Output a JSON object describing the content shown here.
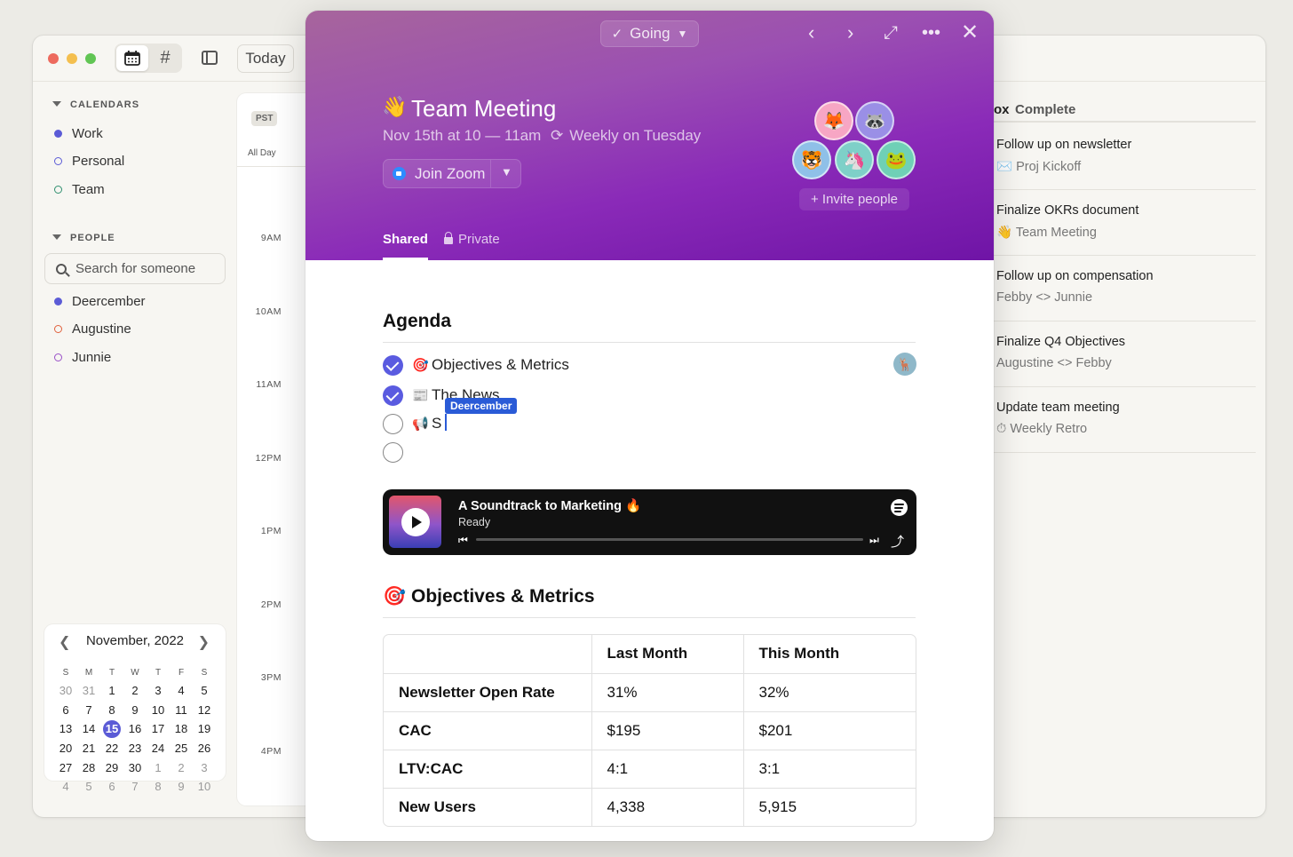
{
  "app": {
    "today_label": "Today",
    "sections": {
      "calendars": "CALENDARS",
      "people": "PEOPLE"
    },
    "calendars": [
      {
        "label": "Work",
        "color": "#5b5bd6",
        "filled": true
      },
      {
        "label": "Personal",
        "color": "#5b5bd6",
        "filled": false
      },
      {
        "label": "Team",
        "color": "#2f8f6f",
        "filled": false
      }
    ],
    "people_search_placeholder": "Search for someone",
    "people": [
      {
        "label": "Deercember",
        "color": "#5b5bd6",
        "filled": true
      },
      {
        "label": "Augustine",
        "color": "#e0603c",
        "filled": false
      },
      {
        "label": "Junnie",
        "color": "#9a50c8",
        "filled": false
      }
    ],
    "mini_calendar": {
      "title": "November, 2022",
      "weekdays": [
        "S",
        "M",
        "T",
        "W",
        "T",
        "F",
        "S"
      ],
      "weeks": [
        [
          "30",
          "31",
          "1",
          "2",
          "3",
          "4",
          "5"
        ],
        [
          "6",
          "7",
          "8",
          "9",
          "10",
          "11",
          "12"
        ],
        [
          "13",
          "14",
          "15",
          "16",
          "17",
          "18",
          "19"
        ],
        [
          "20",
          "21",
          "22",
          "23",
          "24",
          "25",
          "26"
        ],
        [
          "27",
          "28",
          "29",
          "30",
          "1",
          "2",
          "3"
        ],
        [
          "4",
          "5",
          "6",
          "7",
          "8",
          "9",
          "10"
        ]
      ],
      "today": "15"
    },
    "timeline": {
      "timezone": "PST",
      "all_day": "All Day",
      "hours": [
        "9AM",
        "10AM",
        "11AM",
        "12PM",
        "1PM",
        "2PM",
        "3PM",
        "4PM"
      ]
    },
    "tasks": {
      "tab_inbox": "ox",
      "tab_complete": "Complete",
      "items": [
        {
          "title": "Follow up on newsletter",
          "sub": "✉️ Proj Kickoff"
        },
        {
          "title": "Finalize OKRs document",
          "sub": "👋 Team Meeting"
        },
        {
          "title": "Follow up on compensation",
          "sub": "Febby <> Junnie"
        },
        {
          "title": "Finalize Q4 Objectives",
          "sub": "Augustine <> Febby"
        },
        {
          "title": "Update team meeting",
          "sub": "⏱ Weekly Retro"
        }
      ]
    }
  },
  "event": {
    "rsvp": "Going",
    "emoji": "👋",
    "title": "Team Meeting",
    "when": "Nov 15th at 10 — 11am",
    "repeat": "Weekly on Tuesday",
    "zoom_label": "Join Zoom",
    "invite_label": "+ Invite people",
    "tabs": {
      "shared": "Shared",
      "private": "Private"
    },
    "avatars": [
      "🦊",
      "🦝",
      "🐯",
      "🦄",
      "🐸"
    ],
    "agenda_title": "Agenda",
    "agenda": [
      {
        "emoji": "🎯",
        "text": "Objectives & Metrics",
        "checked": true
      },
      {
        "emoji": "📰",
        "text": "The News",
        "checked": true
      },
      {
        "emoji": "📢",
        "text": "S",
        "checked": false
      },
      {
        "emoji": "",
        "text": "",
        "checked": false
      }
    ],
    "cursor_user": "Deercember",
    "player": {
      "title": "A Soundtrack to Marketing 🔥",
      "status": "Ready"
    },
    "metrics_emoji": "🎯",
    "metrics_title": "Objectives & Metrics",
    "table": {
      "headers": [
        "",
        "Last Month",
        "This Month"
      ],
      "rows": [
        [
          "Newsletter Open Rate",
          "31%",
          "32%"
        ],
        [
          "CAC",
          "$195",
          "$201"
        ],
        [
          "LTV:CAC",
          "4:1",
          "3:1"
        ],
        [
          "New Users",
          "4,338",
          "5,915"
        ]
      ]
    }
  }
}
